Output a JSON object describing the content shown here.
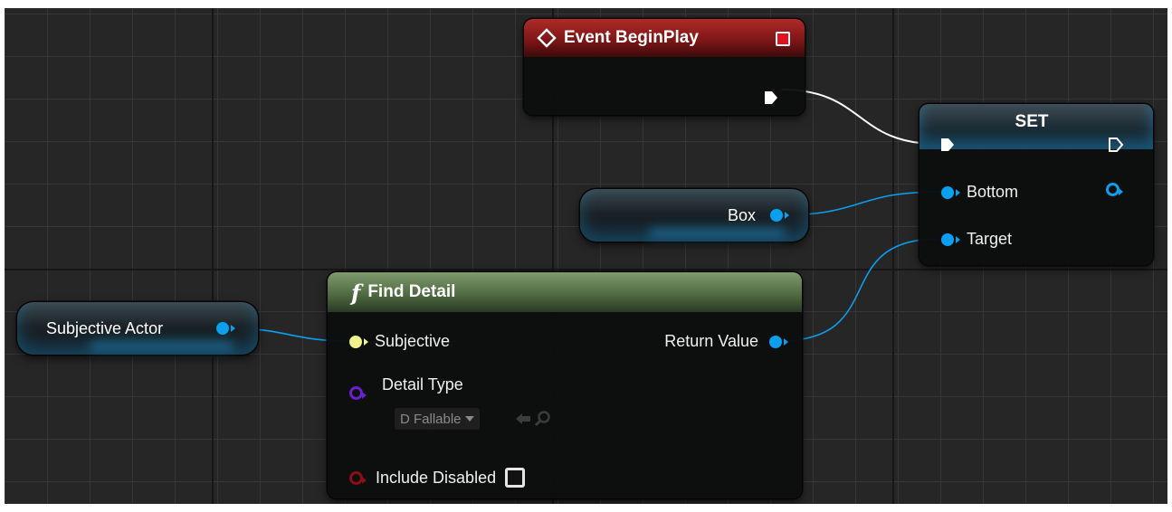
{
  "colors": {
    "event_header": "#8f1d1d",
    "function_header": "#5f7a4e",
    "object_pin": "#0aa0ef",
    "bool_pin": "#8b0f14",
    "struct_pin": "#6a1fd0",
    "detail_pin": "#f0f48a",
    "exec_pin": "#ffffff"
  },
  "nodes": {
    "event_begin_play": {
      "title": "Event BeginPlay",
      "icon": "event-diamond-icon",
      "stop_icon": "stop-square-icon"
    },
    "set": {
      "title": "SET",
      "input_bottom": "Bottom",
      "input_target": "Target"
    },
    "box_var": {
      "label": "Box"
    },
    "subjective_actor_var": {
      "label": "Subjective Actor"
    },
    "find_detail": {
      "icon": "function-icon",
      "icon_glyph": "f",
      "title": "Find Detail",
      "input_subjective": "Subjective",
      "input_detail_type": "Detail Type",
      "detail_type_value": "D Fallable",
      "input_include_disabled": "Include Disabled",
      "include_disabled_checked": false,
      "output_return_value": "Return Value"
    }
  }
}
